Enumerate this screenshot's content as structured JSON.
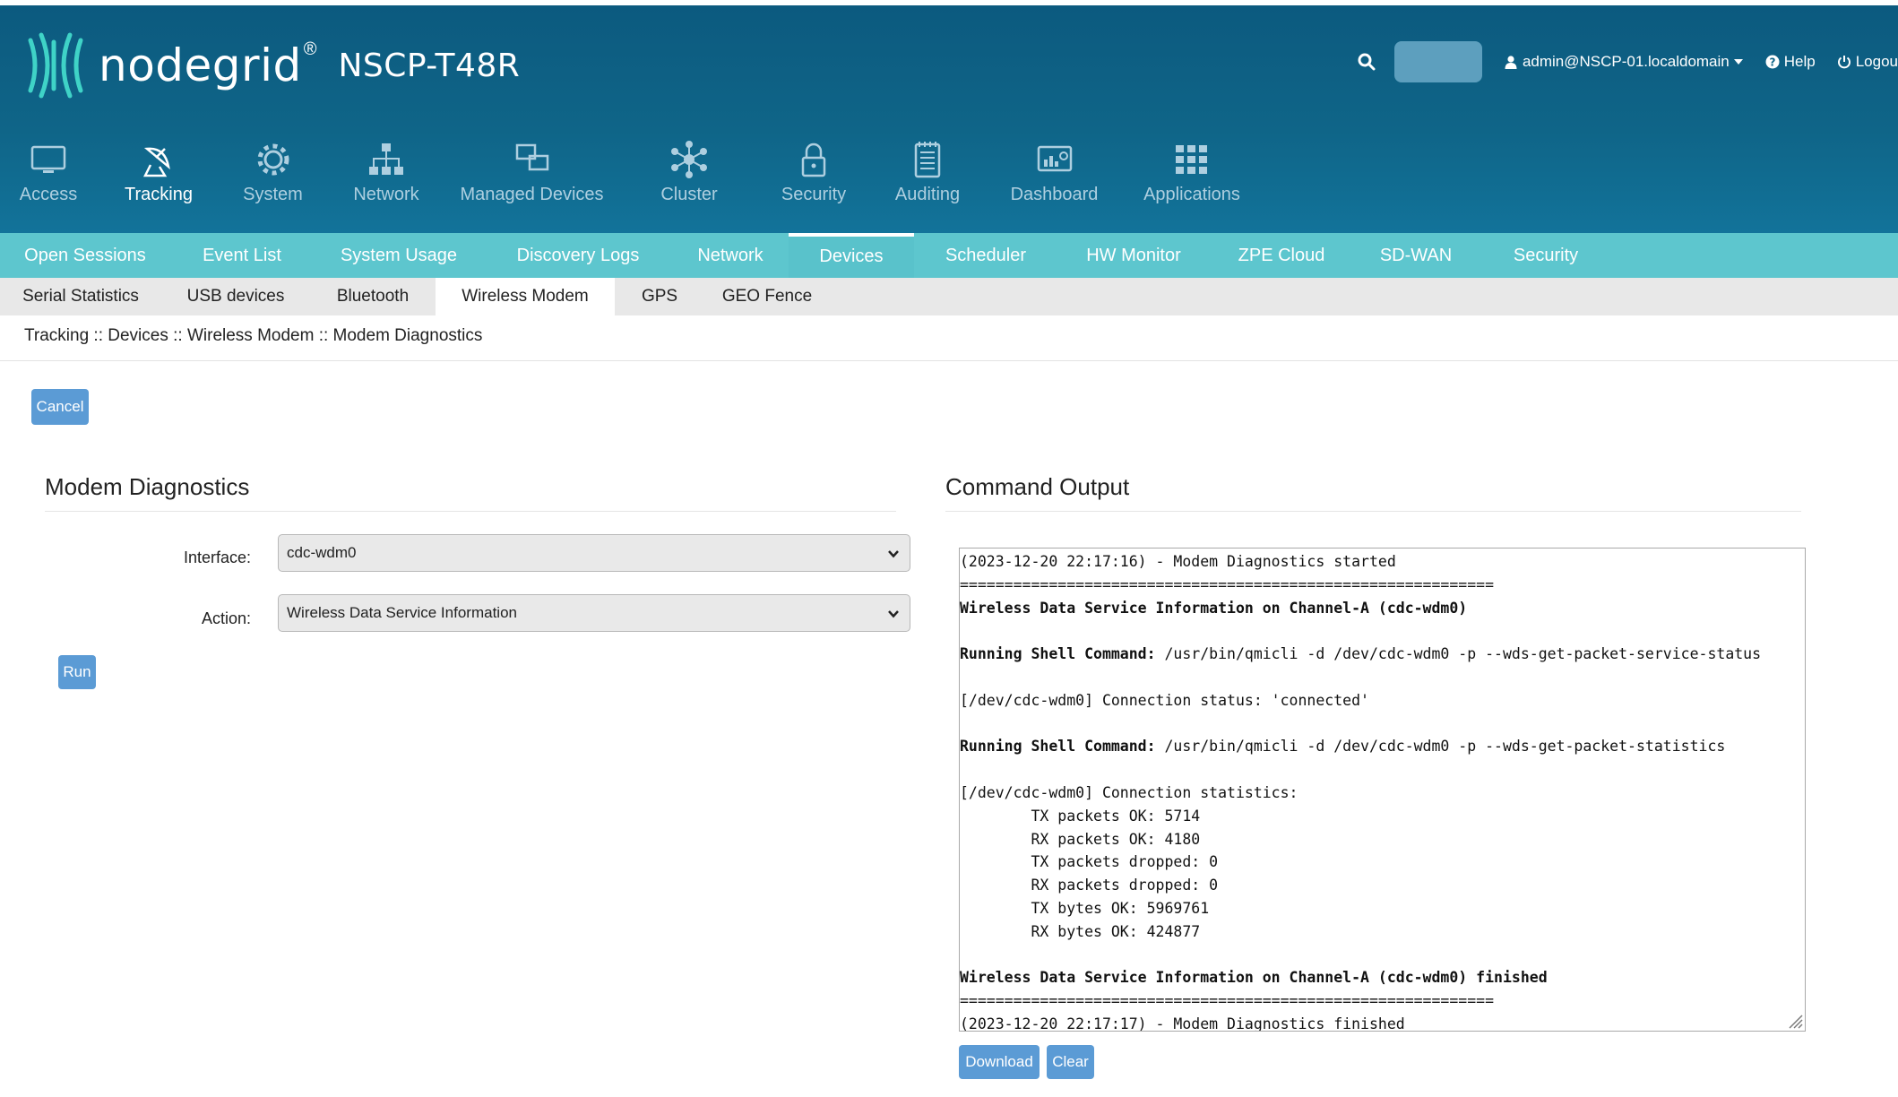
{
  "header": {
    "brand": "nodegrid",
    "registered_mark": "®",
    "model": "NSCP-T48R",
    "user_label": "admin@NSCP-01.localdomain",
    "help_label": "Help",
    "logout_label": "Logou"
  },
  "main_nav": [
    {
      "label": "Access",
      "icon": "monitor-icon"
    },
    {
      "label": "Tracking",
      "icon": "satellite-dish-icon"
    },
    {
      "label": "System",
      "icon": "gear-icon"
    },
    {
      "label": "Network",
      "icon": "network-tree-icon"
    },
    {
      "label": "Managed Devices",
      "icon": "devices-icon"
    },
    {
      "label": "Cluster",
      "icon": "cluster-icon"
    },
    {
      "label": "Security",
      "icon": "lock-icon"
    },
    {
      "label": "Auditing",
      "icon": "notepad-icon"
    },
    {
      "label": "Dashboard",
      "icon": "dashboard-icon"
    },
    {
      "label": "Applications",
      "icon": "grid-icon"
    }
  ],
  "sub_nav": [
    "Open Sessions",
    "Event List",
    "System Usage",
    "Discovery Logs",
    "Network",
    "Devices",
    "Scheduler",
    "HW Monitor",
    "ZPE Cloud",
    "SD-WAN",
    "Security"
  ],
  "sub_nav2": [
    "Serial Statistics",
    "USB devices",
    "Bluetooth",
    "Wireless Modem",
    "GPS",
    "GEO Fence"
  ],
  "breadcrumb": "Tracking :: Devices :: Wireless Modem :: Modem Diagnostics",
  "buttons": {
    "cancel": "Cancel",
    "run": "Run",
    "download": "Download",
    "clear": "Clear"
  },
  "diagnostics": {
    "title": "Modem Diagnostics",
    "interface_label": "Interface:",
    "interface_value": "cdc-wdm0",
    "action_label": "Action:",
    "action_value": "Wireless Data Service Information"
  },
  "output": {
    "title": "Command Output",
    "lines": [
      {
        "text": "(2023-12-20 22:17:16) - Modem Diagnostics started"
      },
      {
        "text": "============================================================"
      },
      {
        "bold": "Wireless Data Service Information on Channel-A (cdc-wdm0)"
      },
      {
        "text": ""
      },
      {
        "bold": "Running Shell Command:",
        "text": " /usr/bin/qmicli -d /dev/cdc-wdm0 -p --wds-get-packet-service-status"
      },
      {
        "text": ""
      },
      {
        "text": "[/dev/cdc-wdm0] Connection status: 'connected'"
      },
      {
        "text": ""
      },
      {
        "bold": "Running Shell Command:",
        "text": " /usr/bin/qmicli -d /dev/cdc-wdm0 -p --wds-get-packet-statistics"
      },
      {
        "text": ""
      },
      {
        "text": "[/dev/cdc-wdm0] Connection statistics:"
      },
      {
        "text": "        TX packets OK: 5714"
      },
      {
        "text": "        RX packets OK: 4180"
      },
      {
        "text": "        TX packets dropped: 0"
      },
      {
        "text": "        RX packets dropped: 0"
      },
      {
        "text": "        TX bytes OK: 5969761"
      },
      {
        "text": "        RX bytes OK: 424877"
      },
      {
        "text": ""
      },
      {
        "bold": "Wireless Data Service Information on Channel-A (cdc-wdm0) finished"
      },
      {
        "text": "============================================================"
      },
      {
        "text": "(2023-12-20 22:17:17) - Modem Diagnostics finished"
      }
    ]
  }
}
